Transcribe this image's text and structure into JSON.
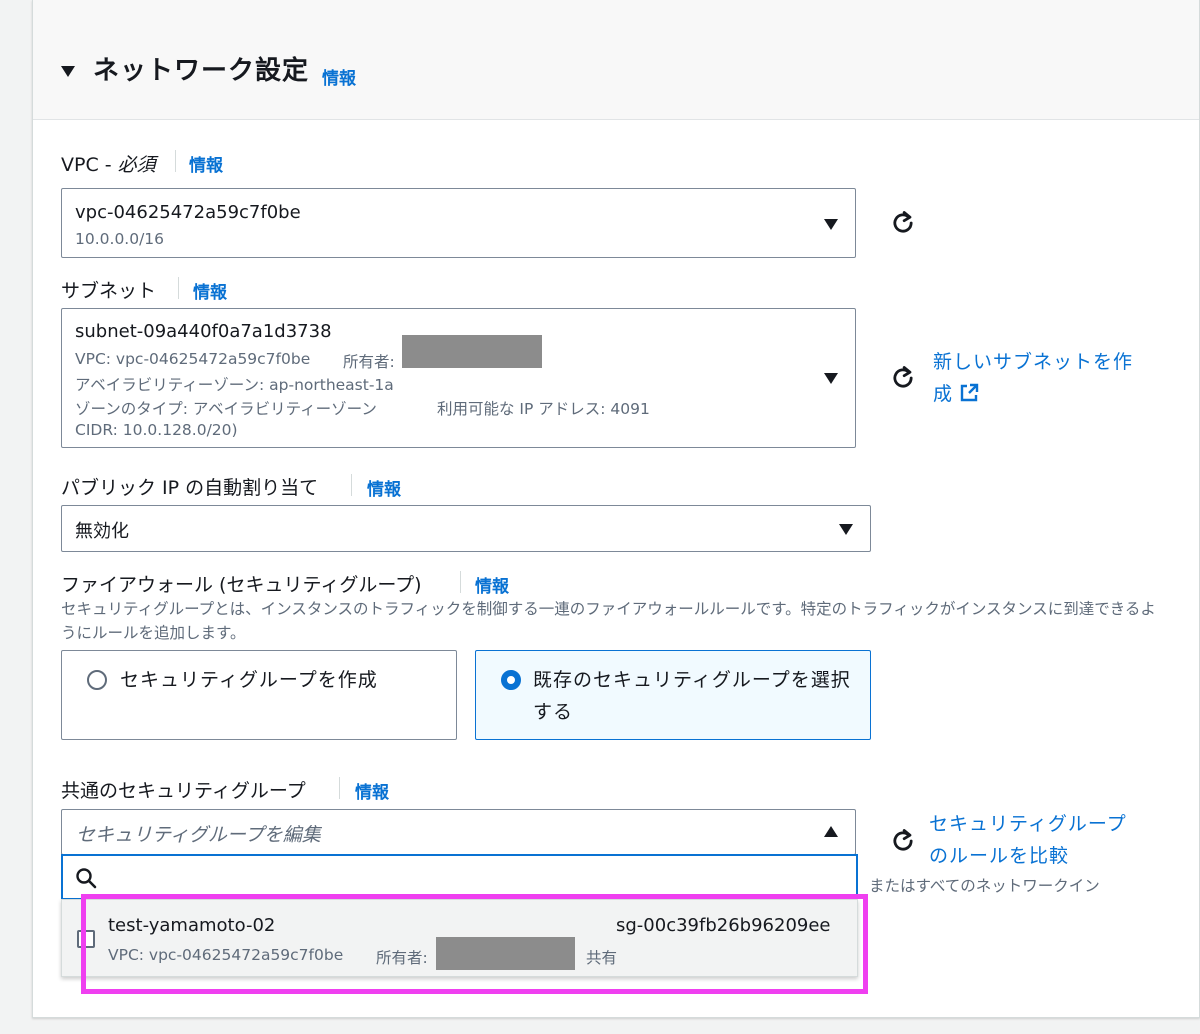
{
  "section": {
    "title": "ネットワーク設定",
    "info": "情報"
  },
  "vpc": {
    "label_main": "VPC - ",
    "label_required": "必須",
    "info": "情報",
    "value": "vpc-04625472a59c7f0be",
    "sub": "10.0.0.0/16"
  },
  "subnet": {
    "label": "サブネット",
    "info": "情報",
    "value": "subnet-09a440f0a7a1d3738",
    "vpc_line": "VPC: vpc-04625472a59c7f0be",
    "owner_label": "所有者:",
    "az_line": "アベイラビリティーゾーン: ap-northeast-1a",
    "zone_type_line": "ゾーンのタイプ: アベイラビリティーゾーン",
    "ip_line": "利用可能な IP アドレス: 4091",
    "cidr_line": "CIDR: 10.0.128.0/20)",
    "create_link": "新しいサブネットを作成"
  },
  "public_ip": {
    "label": "パブリック IP の自動割り当て",
    "info": "情報",
    "value": "無効化"
  },
  "firewall": {
    "label": "ファイアウォール (セキュリティグループ)",
    "info": "情報",
    "description": "セキュリティグループとは、インスタンスのトラフィックを制御する一連のファイアウォールルールです。特定のトラフィックがインスタンスに到達できるようにルールを追加します。",
    "option_create": "セキュリティグループを作成",
    "option_existing": "既存のセキュリティグループを選択する"
  },
  "common_sg": {
    "label": "共通のセキュリティグループ",
    "info": "情報",
    "placeholder": "セキュリティグループを編集",
    "compare_link": "セキュリティグループのルールを比較",
    "hint": "またはすべてのネットワークイン",
    "option": {
      "name": "test-yamamoto-02",
      "id": "sg-00c39fb26b96209ee",
      "vpc": "VPC: vpc-04625472a59c7f0be",
      "owner_label": "所有者:",
      "shared": "共有"
    }
  },
  "colors": {
    "link": "#0972d3",
    "highlight": "#ef3ff0",
    "redaction": "#8c8c8c"
  },
  "icons": [
    "caret-down-icon",
    "refresh-icon",
    "external-link-icon",
    "search-icon"
  ]
}
